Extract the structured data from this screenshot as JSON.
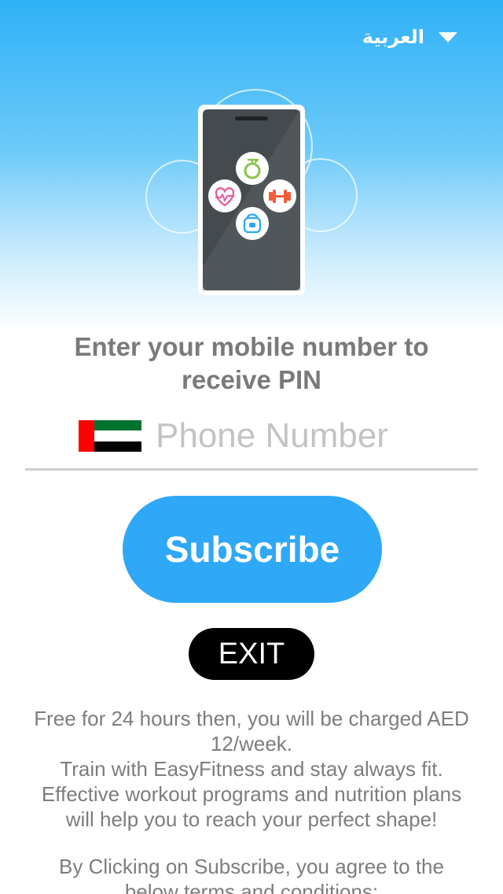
{
  "language_selector": {
    "label": "العربية",
    "icon": "chevron-down-icon"
  },
  "illustration": {
    "icons": [
      "timer-icon",
      "heart-rate-icon",
      "dumbbell-icon",
      "kettlebell-icon"
    ]
  },
  "headline": {
    "line1": "Enter your mobile number to",
    "line2": "receive PIN"
  },
  "phone_field": {
    "flag": "uae-flag-icon",
    "placeholder": "Phone Number",
    "value": ""
  },
  "buttons": {
    "subscribe": "Subscribe",
    "exit": "EXIT"
  },
  "info": {
    "line1": "Free for 24 hours then, you will be charged AED",
    "line2": "12/week.",
    "line3": "Train with EasyFitness and stay always fit.",
    "line4": "Effective workout programs and nutrition plans",
    "line5": "will help you to reach your perfect shape!",
    "line6": "By Clicking on Subscribe, you agree to the",
    "line7": "below terms and conditions:"
  },
  "colors": {
    "hero_top": "#2fb1f7",
    "subscribe_bg": "#2fa8f8",
    "exit_bg": "#000000",
    "text_gray": "#7a7a7a",
    "flag_red": "#ff0000",
    "flag_green": "#00732f",
    "flag_white": "#ffffff",
    "flag_black": "#000000"
  }
}
